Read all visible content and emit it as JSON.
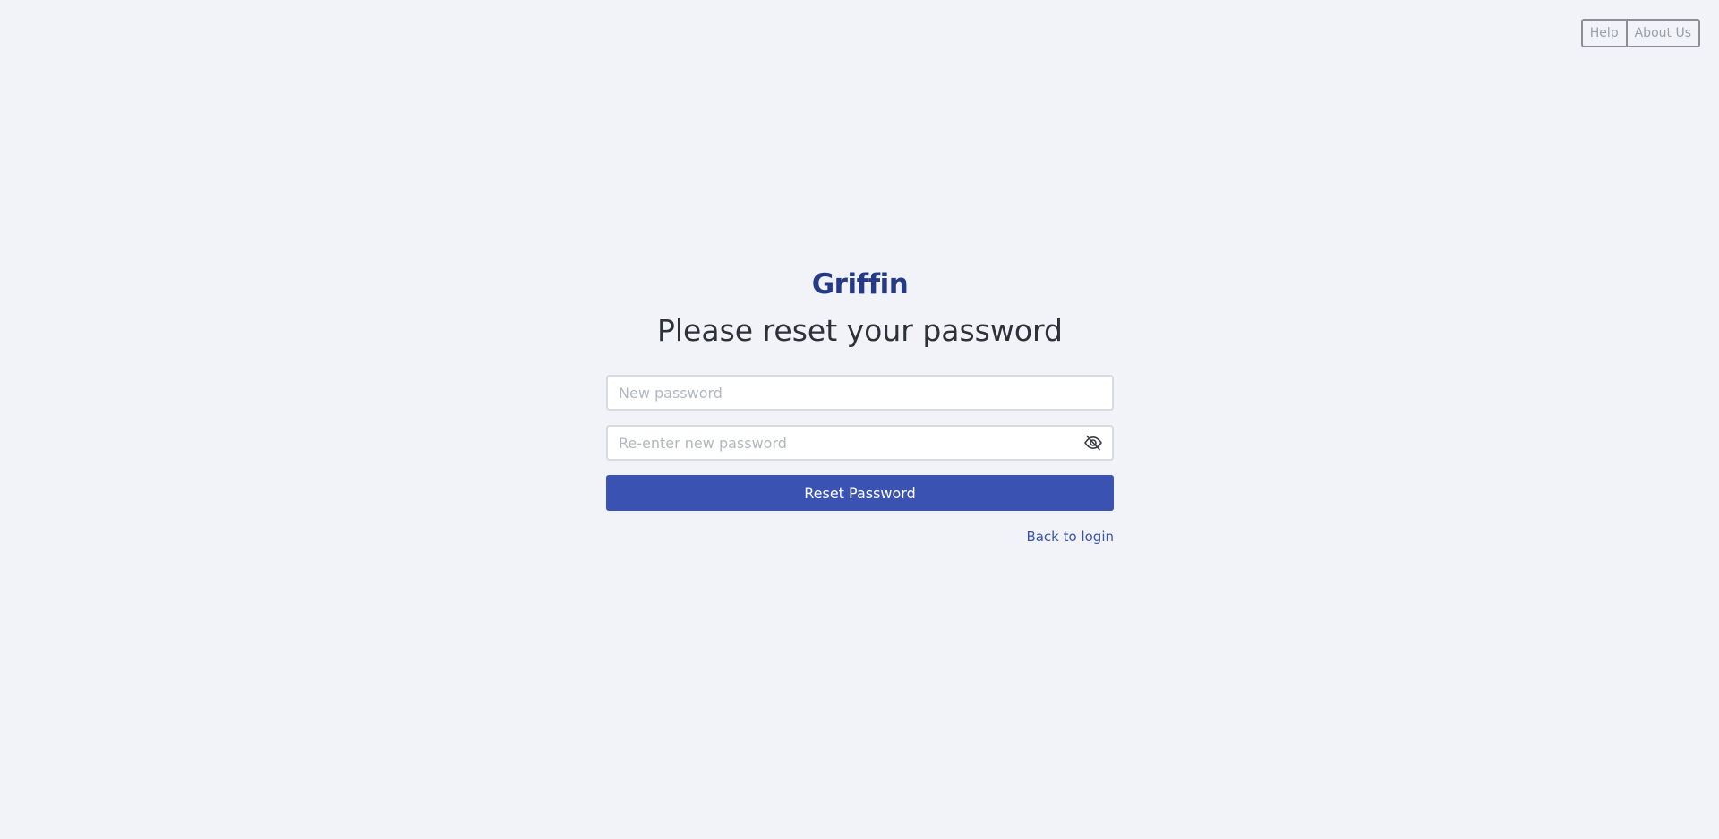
{
  "topnav": {
    "help_label": "Help",
    "about_label": "About Us"
  },
  "brand": {
    "name": "Griffin"
  },
  "page": {
    "title": "Please reset your password"
  },
  "form": {
    "new_password_placeholder": "New password",
    "new_password_value": "",
    "confirm_password_placeholder": "Re-enter new password",
    "confirm_password_value": "",
    "toggle_icon": "eye-slash-icon",
    "submit_label": "Reset Password",
    "back_link_label": "Back to login"
  },
  "colors": {
    "background": "#f1f3f8",
    "accent": "#3a53b3",
    "brand": "#253a86",
    "title_text": "#2d3138",
    "nav_text": "#9aa0a8"
  }
}
